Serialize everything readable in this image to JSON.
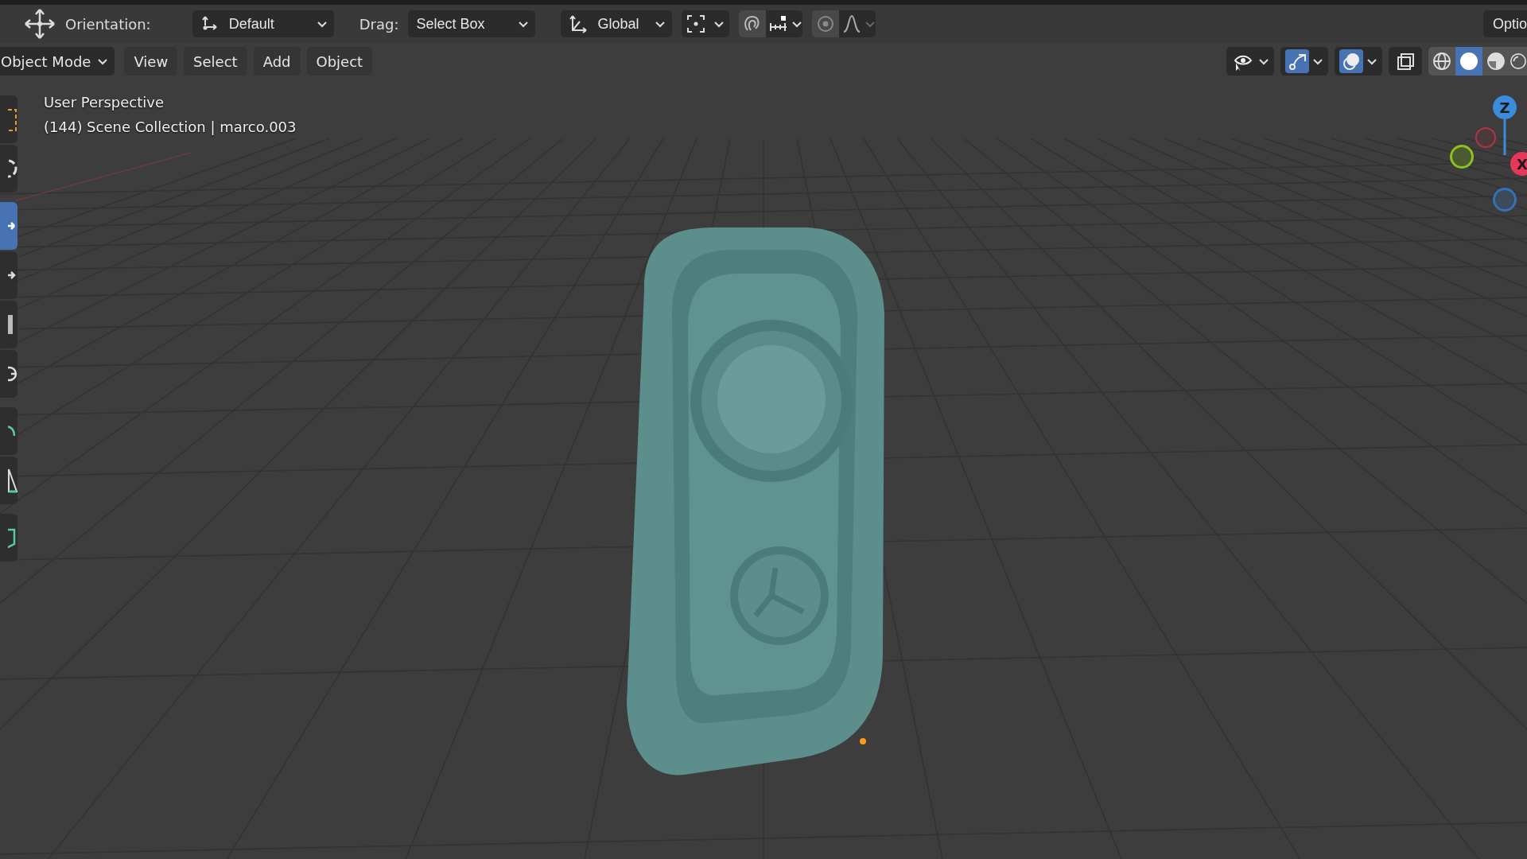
{
  "tool_settings": {
    "orientation_label": "Orientation:",
    "orientation": "Default",
    "drag_label": "Drag:",
    "drag": "Select Box",
    "transform_orientation": "Global",
    "options": "Optio"
  },
  "header": {
    "mode": "Object Mode",
    "menus": [
      "View",
      "Select",
      "Add",
      "Object"
    ],
    "toggles": [
      {
        "kind": "visibility",
        "selected": false
      },
      {
        "kind": "gizmo",
        "selected": true
      },
      {
        "kind": "overlay",
        "selected": true
      },
      {
        "kind": "xray",
        "selected": false
      }
    ],
    "shading": [
      {
        "kind": "wireframe",
        "selected": false
      },
      {
        "kind": "solid",
        "selected": true
      },
      {
        "kind": "material",
        "selected": false
      },
      {
        "kind": "rendered",
        "selected": false
      }
    ]
  },
  "toolbar": [
    {
      "kind": "select",
      "selected": false
    },
    {
      "kind": "cursor",
      "selected": false
    },
    {
      "kind": "move",
      "selected": true
    },
    {
      "kind": "rotate",
      "selected": false
    },
    {
      "kind": "scale",
      "selected": false
    },
    {
      "kind": "transform",
      "selected": false
    },
    {
      "kind": "annotate",
      "selected": false
    },
    {
      "kind": "measure",
      "selected": false
    },
    {
      "kind": "add-cube",
      "selected": false
    }
  ],
  "viewport": {
    "view_name": "User Perspective",
    "object_info": "(144) Scene Collection | marco.003",
    "gizmo_z": "Z",
    "gizmo_x": "X"
  }
}
